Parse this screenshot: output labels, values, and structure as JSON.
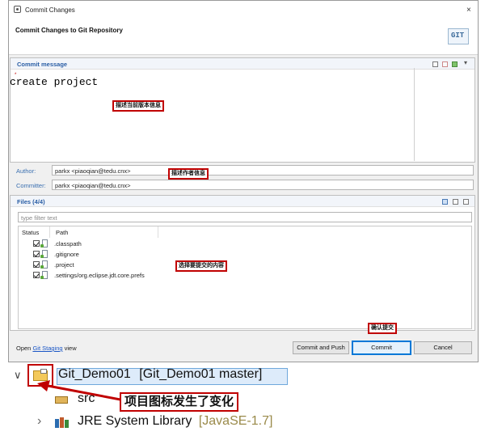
{
  "dialog": {
    "window_title": "Commit Changes",
    "close_symbol": "×",
    "header_title": "Commit Changes to Git Repository",
    "logo_text": "GIT"
  },
  "message": {
    "section_label": "Commit message",
    "text": "create project",
    "note": "描述当前版本信息"
  },
  "author": {
    "label": "Author:",
    "value": "parkx <piaoqian@tedu.cnx>",
    "note": "描述作者信息"
  },
  "committer": {
    "label": "Committer:",
    "value": "parkx <piaoqian@tedu.cnx>"
  },
  "files": {
    "section_label": "Files (4/4)",
    "filter_placeholder": "type filter text",
    "col_status": "Status",
    "col_path": "Path",
    "items": [
      {
        "path": ".classpath",
        "checked": true
      },
      {
        "path": ".gitignore",
        "checked": true
      },
      {
        "path": ".project",
        "checked": true
      },
      {
        "path": ".settings/org.eclipse.jdt.core.prefs",
        "checked": true
      }
    ],
    "note": "选择要提交的内容"
  },
  "footer": {
    "open_prefix": "Open ",
    "open_link": "Git Staging",
    "open_suffix": " view",
    "commit_push_label": "Commit and Push",
    "commit_label": "Commit",
    "cancel_label": "Cancel",
    "commit_note": "确认提交"
  },
  "tree": {
    "project_name": "Git_Demo01",
    "project_repo": "[Git_Demo01 master]",
    "src_label": "src",
    "jre_label": "JRE System Library",
    "jre_version": "[JavaSE-1.7]",
    "expand_open": "∨",
    "expand_closed": "›",
    "change_note": "项目图标发生了变化"
  },
  "colors": {
    "accent": "#2a5ea5",
    "annotation": "#c00000",
    "commit_focus": "#0078d7"
  }
}
